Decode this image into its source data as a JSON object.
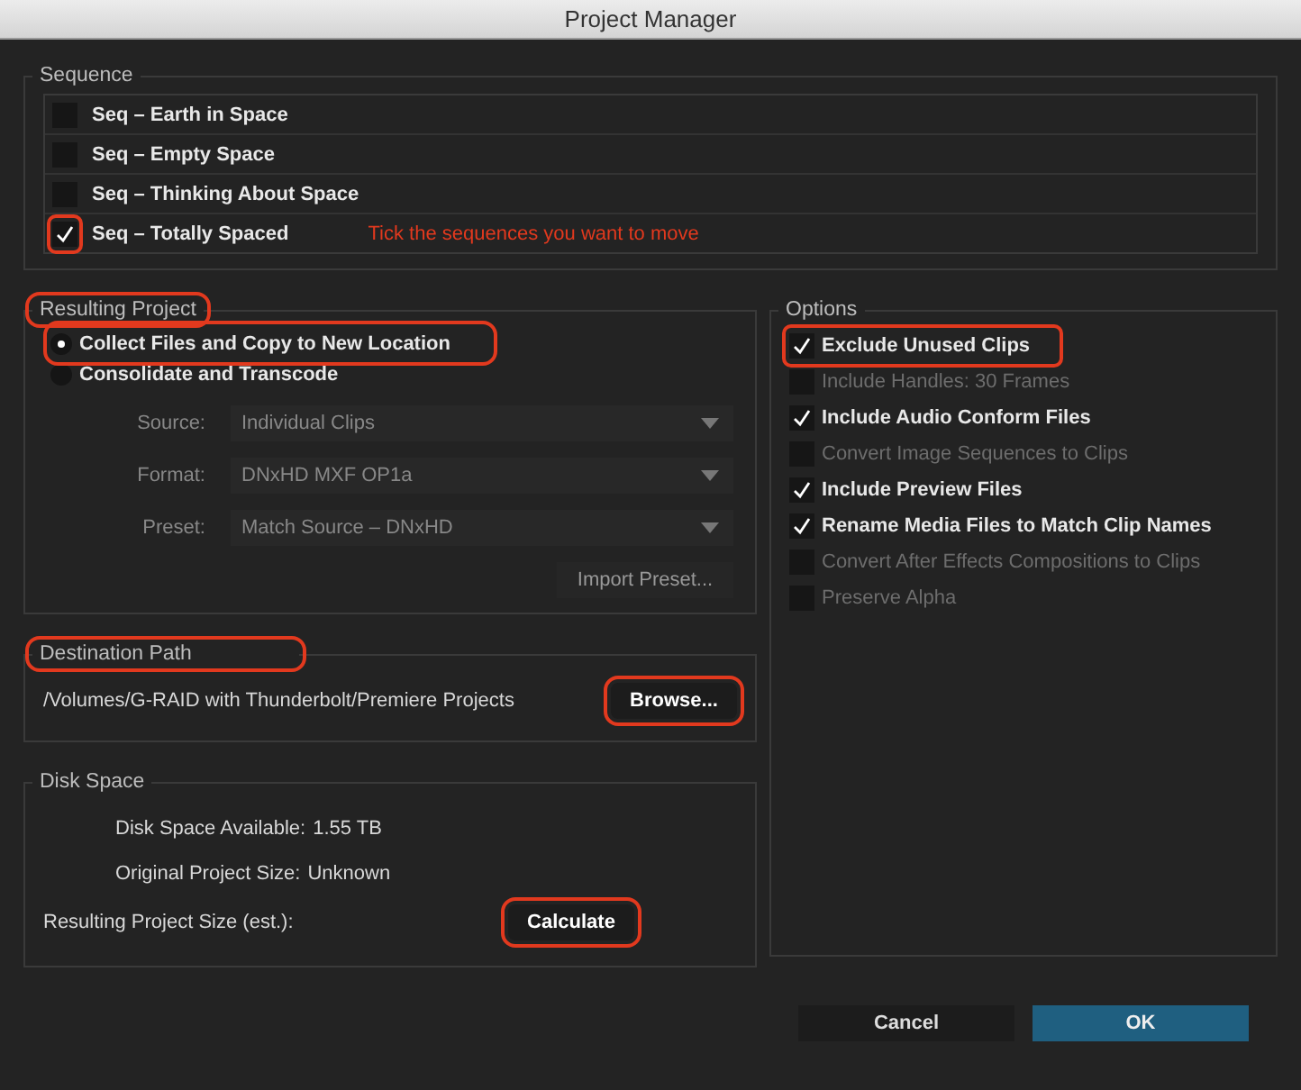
{
  "window": {
    "title": "Project Manager"
  },
  "sequence": {
    "label": "Sequence",
    "hint": "Tick the sequences you want to move",
    "items": [
      {
        "label": "Seq – Earth in Space",
        "checked": false,
        "highlighted": false
      },
      {
        "label": "Seq – Empty Space",
        "checked": false,
        "highlighted": false
      },
      {
        "label": "Seq – Thinking About Space",
        "checked": false,
        "highlighted": false
      },
      {
        "label": "Seq – Totally Spaced",
        "checked": true,
        "highlighted": true
      }
    ]
  },
  "resulting_project": {
    "label": "Resulting Project",
    "label_highlighted": true,
    "choices": [
      {
        "label": "Collect Files and Copy to New Location",
        "selected": true,
        "highlighted": true
      },
      {
        "label": "Consolidate and Transcode",
        "selected": false,
        "highlighted": false
      }
    ],
    "fields": [
      {
        "label": "Source:",
        "value": "Individual Clips"
      },
      {
        "label": "Format:",
        "value": "DNxHD MXF OP1a"
      },
      {
        "label": "Preset:",
        "value": "Match Source – DNxHD"
      }
    ],
    "import_button": "Import Preset..."
  },
  "options": {
    "label": "Options",
    "items": [
      {
        "label": "Exclude Unused Clips",
        "checked": true,
        "disabled": false,
        "highlighted": true
      },
      {
        "label": "Include Handles:  30 Frames",
        "checked": false,
        "disabled": true,
        "highlighted": false
      },
      {
        "label": "Include Audio Conform Files",
        "checked": true,
        "disabled": false,
        "highlighted": false
      },
      {
        "label": "Convert Image Sequences to Clips",
        "checked": false,
        "disabled": true,
        "highlighted": false
      },
      {
        "label": "Include Preview Files",
        "checked": true,
        "disabled": false,
        "highlighted": false
      },
      {
        "label": "Rename Media Files to Match Clip Names",
        "checked": true,
        "disabled": false,
        "highlighted": false
      },
      {
        "label": "Convert After Effects Compositions to Clips",
        "checked": false,
        "disabled": true,
        "highlighted": false
      },
      {
        "label": "Preserve Alpha",
        "checked": false,
        "disabled": true,
        "highlighted": false
      }
    ]
  },
  "destination": {
    "label": "Destination Path",
    "label_highlighted": true,
    "path": "/Volumes/G-RAID with Thunderbolt/Premiere Projects",
    "browse_button": "Browse...",
    "browse_highlighted": true
  },
  "disk_space": {
    "label": "Disk Space",
    "rows": [
      {
        "label": "Disk Space Available:",
        "value": "1.55 TB"
      },
      {
        "label": "Original Project Size:",
        "value": "Unknown"
      }
    ],
    "result_label": "Resulting Project Size (est.):",
    "calculate_button": "Calculate",
    "calculate_highlighted": true
  },
  "buttons": [
    {
      "label": "Cancel",
      "kind": "secondary"
    },
    {
      "label": "OK",
      "kind": "primary"
    }
  ]
}
